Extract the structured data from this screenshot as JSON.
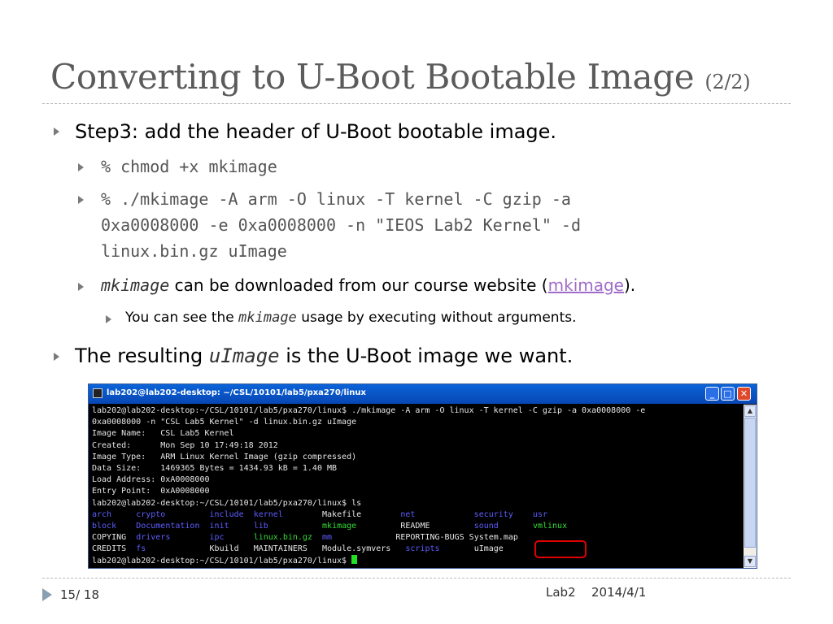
{
  "slide": {
    "title": "Converting to U-Boot Bootable Image",
    "title_part": "(2/2)"
  },
  "bullets": {
    "step3": "Step3: add the header of U-Boot bootable image.",
    "cmd1": "% chmod +x mkimage",
    "cmd2_line1": "% ./mkimage -A arm -O linux -T kernel -C gzip -a",
    "cmd2_line2": "0xa0008000 -e 0xa0008000 -n \"IEOS Lab2 Kernel\" -d",
    "cmd2_line3": "linux.bin.gz uImage",
    "download_code": "mkimage",
    "download_text": "can be downloaded from our course website (",
    "download_link": "mkimage",
    "download_end": ").",
    "usage_pre": "You can see the ",
    "usage_code": "mkimage",
    "usage_post": " usage by executing without arguments.",
    "result_pre": "The resulting ",
    "result_code": "uImage",
    "result_post": " is the U-Boot image we want."
  },
  "terminal": {
    "title": "lab202@lab202-desktop: ~/CSL/10101/lab5/pxa270/linux",
    "lines": [
      "lab202@lab202-desktop:~/CSL/10101/lab5/pxa270/linux$ ./mkimage -A arm -O linux -T kernel -C gzip -a 0xa0008000 -e",
      "0xa0008000 -n \"CSL Lab5 Kernel\" -d linux.bin.gz uImage",
      "Image Name:   CSL Lab5 Kernel",
      "Created:      Mon Sep 10 17:49:18 2012",
      "Image Type:   ARM Linux Kernel Image (gzip compressed)",
      "Data Size:    1469365 Bytes = 1434.93 kB = 1.40 MB",
      "Load Address: 0xA0008000",
      "Entry Point:  0xA0008000",
      "lab202@lab202-desktop:~/CSL/10101/lab5/pxa270/linux$ ls"
    ],
    "ls": {
      "r1": [
        "arch",
        "crypto",
        "include",
        "kernel",
        "Makefile",
        "net",
        "security",
        "usr"
      ],
      "r2": [
        "block",
        "Documentation",
        "init",
        "lib",
        "mkimage",
        "README",
        "sound",
        "vmlinux"
      ],
      "r3": [
        "COPYING",
        "drivers",
        "ipc",
        "linux.bin.gz",
        "mm",
        "REPORTING-BUGS",
        "System.map"
      ],
      "r4": [
        "CREDITS",
        "fs",
        "Kbuild",
        "MAINTAINERS",
        "Module.symvers",
        "scripts",
        "uImage"
      ]
    },
    "prompt": "lab202@lab202-desktop:~/CSL/10101/lab5/pxa270/linux$ "
  },
  "footer": {
    "page": "15/ 18",
    "label": "Lab2",
    "date": "2014/4/1"
  }
}
